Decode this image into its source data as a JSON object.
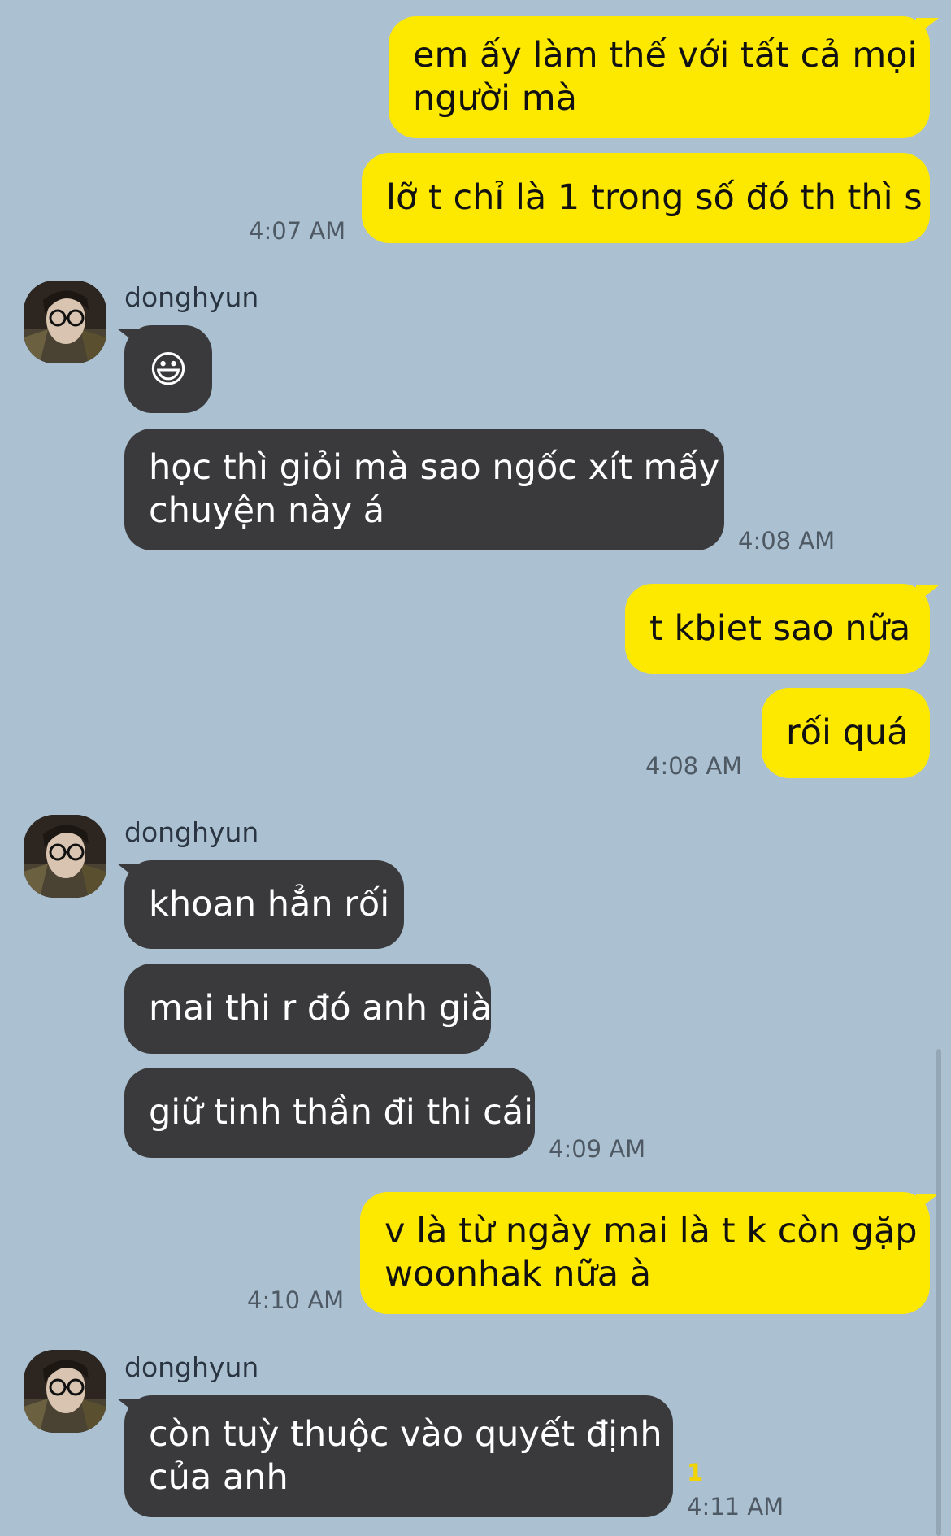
{
  "contact": {
    "name": "donghyun"
  },
  "messages": [
    {
      "id": "m1",
      "from": "me",
      "text_lines": [
        "em ấy làm thế với tất cả mọi",
        "người mà"
      ]
    },
    {
      "id": "m2",
      "from": "me",
      "text": "lỡ t chỉ là 1 trong số đó th thì s",
      "time": "4:07 AM"
    },
    {
      "id": "m3",
      "from": "donghyun",
      "sender_name": "donghyun",
      "emoji": "😃"
    },
    {
      "id": "m4",
      "from": "donghyun",
      "text_lines": [
        "học thì giỏi mà sao ngốc xít mấy",
        "chuyện này á"
      ],
      "time": "4:08 AM"
    },
    {
      "id": "m5",
      "from": "me",
      "text": "t kbiet sao nữa"
    },
    {
      "id": "m6",
      "from": "me",
      "text": "rối quá",
      "time": "4:08 AM"
    },
    {
      "id": "m7",
      "from": "donghyun",
      "sender_name": "donghyun",
      "text": "khoan hẳn rối"
    },
    {
      "id": "m8",
      "from": "donghyun",
      "text": "mai thi r đó anh già"
    },
    {
      "id": "m9",
      "from": "donghyun",
      "text": "giữ tinh thần đi thi cái",
      "time": "4:09 AM"
    },
    {
      "id": "m10",
      "from": "me",
      "text_lines": [
        "v là từ ngày mai là t k còn gặp",
        "woonhak nữa à"
      ],
      "time": "4:10 AM"
    },
    {
      "id": "m11",
      "from": "donghyun",
      "sender_name": "donghyun",
      "text_lines": [
        "còn tuỳ thuộc vào quyết định",
        "của anh"
      ],
      "time": "4:11 AM",
      "unread_count": "1"
    }
  ],
  "colors": {
    "background": "#abc1d2",
    "my_bubble": "#fde800",
    "their_bubble": "#3a3a3c",
    "unread": "#f1d300"
  },
  "icons": {
    "avatar": "profile-photo-avatar"
  }
}
